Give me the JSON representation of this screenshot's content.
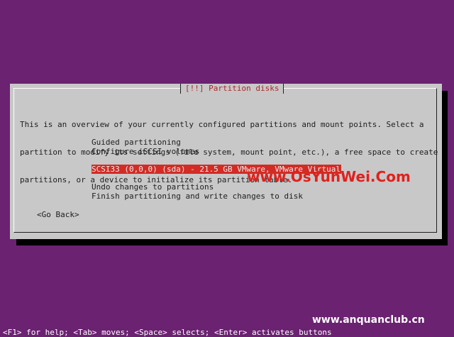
{
  "dialog": {
    "title": "[!!] Partition disks",
    "intro_lines": [
      "This is an overview of your currently configured partitions and mount points. Select a",
      "partition to modify its settings (file system, mount point, etc.), a free space to create",
      "partitions, or a device to initialize its partition table."
    ],
    "menu": {
      "guided": "Guided partitioning",
      "iscsi": "Configure iSCSI volumes",
      "disk": "SCSI33 (0,0,0) (sda) - 21.5 GB VMware, VMware Virtual S",
      "undo": "Undo changes to partitions",
      "finish": "Finish partitioning and write changes to disk"
    },
    "go_back": "<Go Back>"
  },
  "watermarks": {
    "primary": "www.OsYunWei.Com",
    "secondary": "www.anquanclub.cn"
  },
  "status_bar": "<F1> for help; <Tab> moves; <Space> selects; <Enter> activates buttons",
  "colors": {
    "background": "#6b2271",
    "dialog": "#c8c8c8",
    "selection": "#d22c25",
    "title": "#b02828"
  }
}
